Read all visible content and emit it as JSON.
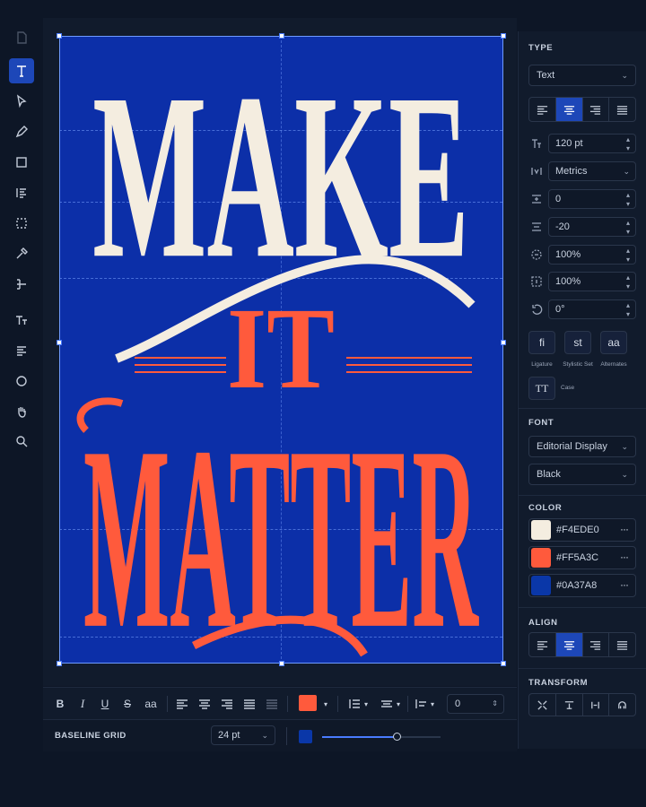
{
  "artwork": {
    "line1": "MAKE",
    "line2": "IT",
    "line3": "MATTER"
  },
  "format_bar": {
    "bold": "B",
    "italic": "I",
    "underline": "U",
    "strike": "S",
    "case": "aa",
    "spacing_value": "0"
  },
  "baseline": {
    "label": "BASELINE GRID",
    "size": "24 pt",
    "slider_level": 0.63
  },
  "panel": {
    "type": {
      "title": "TYPE",
      "mode": "Text",
      "size": "120 pt",
      "kerning": "Metrics",
      "tracking": "0",
      "leading": "-20",
      "scale_h": "100%",
      "scale_v": "100%",
      "rotation": "0°",
      "features": [
        {
          "glyph": "fi",
          "label": "Ligature"
        },
        {
          "glyph": "st",
          "label": "Stylistic Set"
        },
        {
          "glyph": "aa",
          "label": "Alternates"
        },
        {
          "glyph": "TT",
          "label": "Case"
        }
      ]
    },
    "font": {
      "title": "FONT",
      "family": "Editorial Display",
      "weight": "Black"
    },
    "color": {
      "title": "COLOR",
      "swatches": [
        {
          "hex": "#F4EDE0",
          "color": "#F4EDE0"
        },
        {
          "hex": "#FF5A3C",
          "color": "#FF5A3C"
        },
        {
          "hex": "#0A37A8",
          "color": "#0A37A8"
        }
      ]
    },
    "align": {
      "title": "ALIGN"
    },
    "transform": {
      "title": "TRANSFORM"
    }
  },
  "colors": {
    "cream": "#F4EDE0",
    "orange": "#FF5A3C",
    "blue": "#0A37A8",
    "accent": "#1D47B8"
  }
}
